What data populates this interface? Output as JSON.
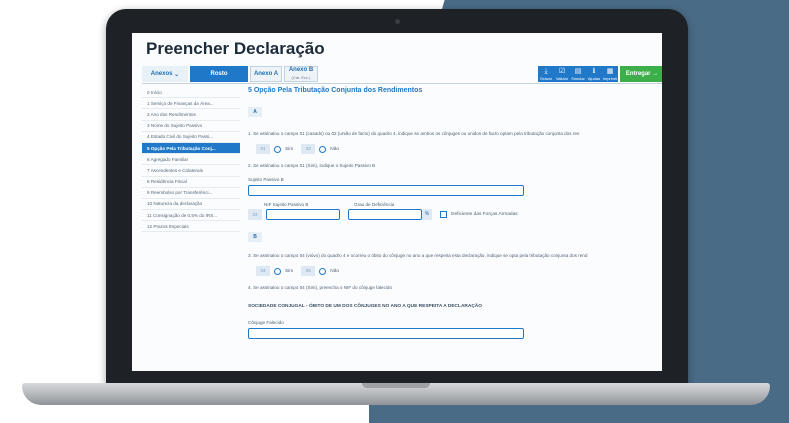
{
  "app": {
    "title": "Preencher Declaração"
  },
  "tabs": {
    "anexos": "Anexos",
    "rosto": "Rosto",
    "anexo_a": "Anexo A",
    "anexo_b": "Anexo B",
    "anexo_b_sub": "(Cat. Ecc.)"
  },
  "toolbar": [
    {
      "label": "Gravar",
      "icon": "download-icon"
    },
    {
      "label": "Validar",
      "icon": "check-icon"
    },
    {
      "label": "Simular",
      "icon": "calculator-icon"
    },
    {
      "label": "Ajudas",
      "icon": "info-icon"
    },
    {
      "label": "Imprimir",
      "icon": "print-icon"
    }
  ],
  "entregar": "Entregar →",
  "sidebar": [
    {
      "label": "0  Início"
    },
    {
      "label": "1  Serviço de Finanças da Área..."
    },
    {
      "label": "2  Ano dos Rendimentos"
    },
    {
      "label": "3  Nome do Sujeito Passivo"
    },
    {
      "label": "4  Estado Civil do Sujeito Passi..."
    },
    {
      "label": "5  Opção Pela Tributação Conj...",
      "active": true
    },
    {
      "label": "6  Agregado Familiar"
    },
    {
      "label": "7  Ascendentes e Colaterais"
    },
    {
      "label": "8  Residência Fiscal"
    },
    {
      "label": "9  Reembolso por Transferênci..."
    },
    {
      "label": "10  Natureza da declaração"
    },
    {
      "label": "11  Consignação de 0,5% do IRS..."
    },
    {
      "label": "12  Prazos Especiais"
    }
  ],
  "main": {
    "title": "5  Opção Pela Tributação Conjunta dos Rendimentos",
    "section_a": "A",
    "q1": "1. Se assinalou o campo 01 (casado) ou 02 (união de facto) do quadro 4, indique se ambos os cônjuges ou unidos de facto optam pela tributação conjunta dos ren",
    "code01": "01",
    "sim": "Sim",
    "code02": "02",
    "nao": "Não",
    "q2": "2. Se assinalou o campo 01 (Sim), indique o Sujeito Passivo B",
    "sp_b_label": "Sujeito Passivo B",
    "nif_label": "NIF Sujeito Passivo B",
    "grau_label": "Grau de Deficiência",
    "code03": "03",
    "pct": "%",
    "deficiente_label": "Deficiente das Forças Armadas",
    "section_b": "B",
    "q3": "3. Se assinalou o campo 04 (viúvo) do quadro 4 e ocorreu o óbito do cônjuge no ano a que respeita esta declaração, indique se opta pela tributação conjunta dos rend",
    "code04": "04",
    "code05": "05",
    "q4": "4. Se assinalou o campo 04 (Sim), preencha o NIF do cônjuge falecido",
    "subhead": "SOCIEDADE CONJUGAL - ÓBITO DE UM DOS CÔNJUGES NO ANO A QUE RESPEITA A DECLARAÇÃO",
    "conjuge_label": "Cônjuge Falecido"
  }
}
